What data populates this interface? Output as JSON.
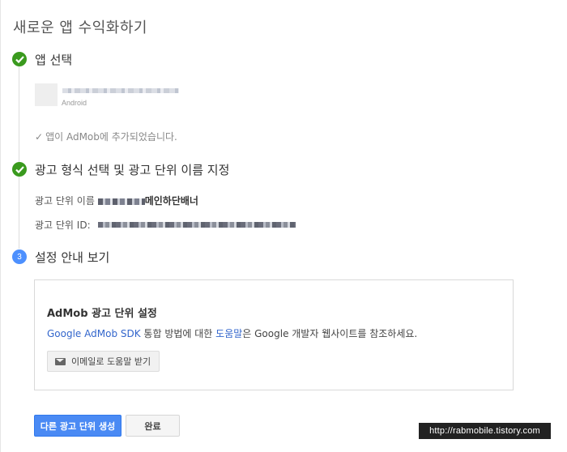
{
  "page": {
    "title": "새로운 앱 수익화하기"
  },
  "steps": [
    {
      "status": "done",
      "title": "앱 선택"
    },
    {
      "status": "done",
      "title": "광고 형식 선택 및 광고 단위 이름 지정"
    },
    {
      "status": "current",
      "number": "3",
      "title": "설정 안내 보기"
    }
  ],
  "app": {
    "platform": "Android",
    "added_message": "앱이 AdMob에 추가되었습니다.",
    "check_glyph": "✓"
  },
  "ad_unit": {
    "name_label": "광고 단위 이름",
    "name_value_visible": "메인하단배너",
    "id_label": "광고 단위 ID:"
  },
  "guide_box": {
    "title": "AdMob 광고 단위 설정",
    "desc_link1": "Google AdMob SDK",
    "desc_text1": " 통합 방법에 대한 ",
    "desc_link2": "도움말",
    "desc_text2": "은 Google 개발자 웹사이트를 참조하세요.",
    "email_button_label": "이메일로 도움말 받기",
    "email_icon": "envelope-icon"
  },
  "footer": {
    "primary_button_label": "다른 광고 단위 생성",
    "secondary_button_label": "완료"
  },
  "watermark": {
    "text": "http://rabmobile.tistory.com"
  },
  "colors": {
    "success": "#3a9a1e",
    "step_current": "#4d90fe",
    "link": "#3366cc",
    "primary_button": "#4a8af4"
  }
}
